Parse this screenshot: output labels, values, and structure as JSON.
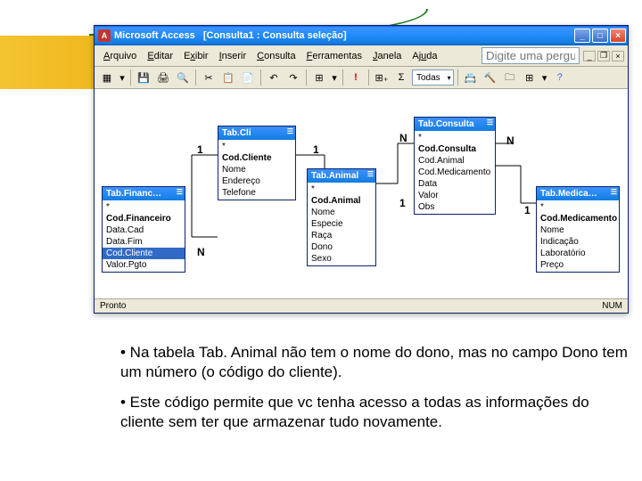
{
  "titlebar": {
    "app": "Microsoft Access",
    "doc": "[Consulta1 : Consulta seleção]"
  },
  "menu": {
    "arquivo": "Arquivo",
    "editar": "Editar",
    "exibir": "Exibir",
    "inserir": "Inserir",
    "consulta": "Consulta",
    "ferramentas": "Ferramentas",
    "janela": "Janela",
    "ajuda": "Ajuda",
    "help_placeholder": "Digite uma pergunta"
  },
  "toolbar": {
    "todas": "Todas"
  },
  "tables": {
    "cli": {
      "title": "Tab.Cli",
      "fields": [
        "*",
        "Cod.Cliente",
        "Nome",
        "Endereço",
        "Telefone"
      ]
    },
    "financ": {
      "title": "Tab.Financ…",
      "fields": [
        "*",
        "Cod.Financeiro",
        "Data.Cad",
        "Data.Fim",
        "Cod.Cliente",
        "Valor.Pgto"
      ]
    },
    "animal": {
      "title": "Tab.Animal",
      "fields": [
        "*",
        "Cod.Animal",
        "Nome",
        "Especie",
        "Raça",
        "Dono",
        "Sexo"
      ]
    },
    "consulta": {
      "title": "Tab.Consulta",
      "fields": [
        "*",
        "Cod.Consulta",
        "Cod.Animal",
        "Cod.Medicamento",
        "Data",
        "Valor",
        "Obs"
      ]
    },
    "medica": {
      "title": "Tab.Medica…",
      "fields": [
        "*",
        "Cod.Medicamento",
        "Nome",
        "Indicação",
        "Laboratório",
        "Preço"
      ]
    }
  },
  "cardinality": {
    "one": "1",
    "many": "N"
  },
  "status": {
    "ready": "Pronto",
    "num": "NUM"
  },
  "bullets": {
    "p1": "• Na tabela Tab. Animal não tem o nome do dono, mas no campo Dono tem um número (o código do cliente).",
    "p2": "• Este código permite que vc tenha acesso a todas as informações do cliente sem ter que armazenar tudo novamente."
  }
}
